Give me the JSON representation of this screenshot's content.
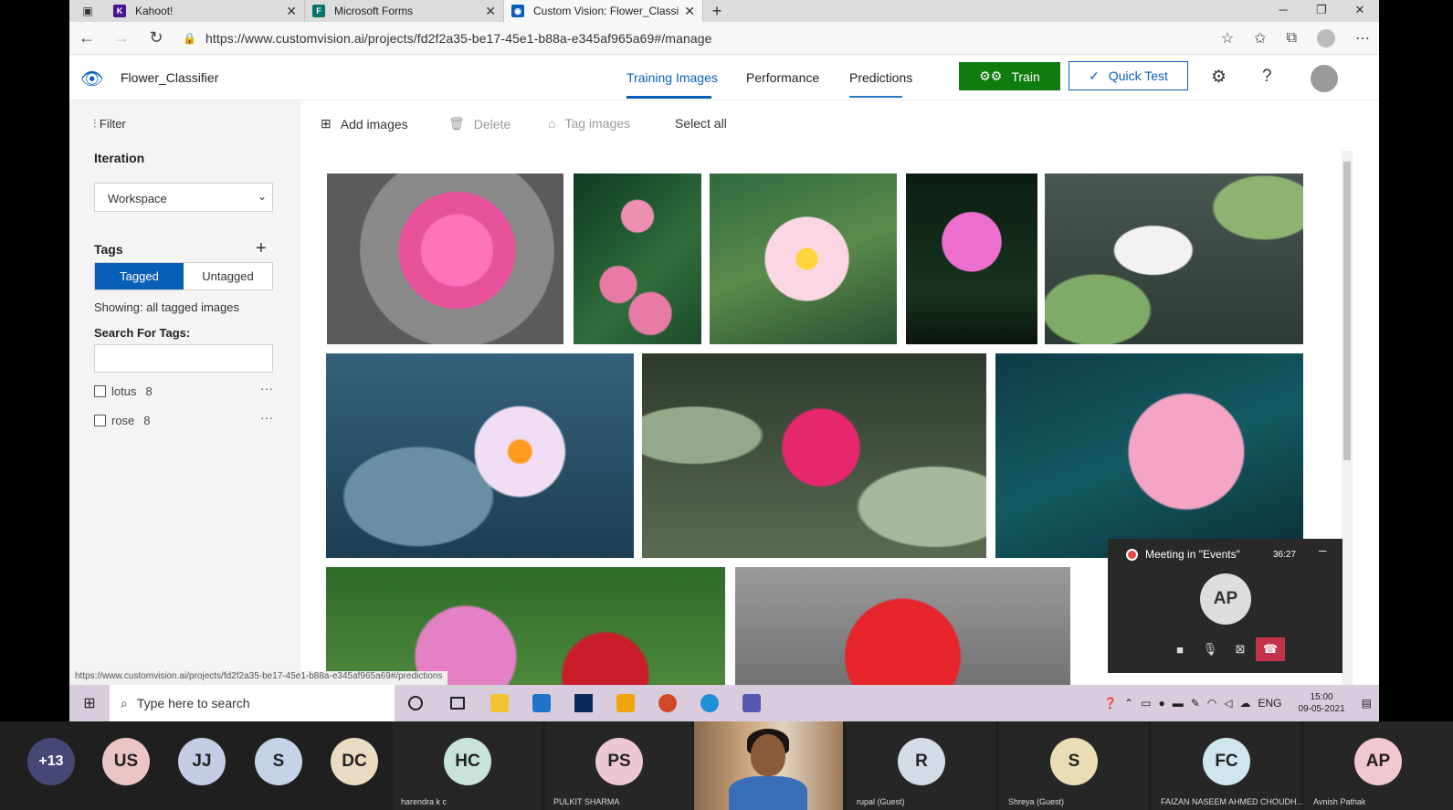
{
  "browser": {
    "tabs": [
      {
        "label": "Kahoot!",
        "icon": "kahoot-icon",
        "color": "#46178f"
      },
      {
        "label": "Microsoft Forms",
        "icon": "forms-icon",
        "color": "#077568"
      },
      {
        "label": "Custom Vision: Flower_Classifier",
        "icon": "customvision-icon",
        "color": "#0a5eb8",
        "active": true
      }
    ],
    "url": "https://www.customvision.ai/projects/fd2f2a35-be17-45e1-b88a-e345af965a69#/manage",
    "status_url": "https://www.customvision.ai/projects/fd2f2a35-be17-45e1-b88a-e345af965a69#/predictions"
  },
  "app": {
    "project_name": "Flower_Classifier",
    "nav": [
      "Training Images",
      "Performance",
      "Predictions"
    ],
    "active_nav": "Training Images",
    "train_label": "Train",
    "quick_test_label": "Quick Test",
    "accent_color": "#0a5eb8",
    "train_color": "#107c10"
  },
  "sidebar": {
    "filter_label": "Filter",
    "iteration_heading": "Iteration",
    "iteration_value": "Workspace",
    "tags_heading": "Tags",
    "tagged_label": "Tagged",
    "untagged_label": "Untagged",
    "showing_text": "Showing: all tagged images",
    "search_label": "Search For Tags:",
    "search_value": "",
    "tags": [
      {
        "name": "lotus",
        "count": "8"
      },
      {
        "name": "rose",
        "count": "8"
      }
    ]
  },
  "toolbar": {
    "add_images": "Add images",
    "delete": "Delete",
    "tag_images": "Tag images",
    "select_all": "Select all"
  },
  "gallery": {
    "images": [
      {
        "subject": "pink lotus",
        "tag": "lotus"
      },
      {
        "subject": "lotus buds",
        "tag": "lotus"
      },
      {
        "subject": "pink-white lotus",
        "tag": "lotus"
      },
      {
        "subject": "magenta lotus on dark",
        "tag": "lotus"
      },
      {
        "subject": "white lotus on pads",
        "tag": "lotus"
      },
      {
        "subject": "white lotus on water",
        "tag": "lotus"
      },
      {
        "subject": "red lotus on pads",
        "tag": "lotus"
      },
      {
        "subject": "pink lotus on blue",
        "tag": "lotus"
      },
      {
        "subject": "pink and red roses",
        "tag": "rose"
      },
      {
        "subject": "red rose",
        "tag": "rose"
      }
    ]
  },
  "meeting": {
    "title": "Meeting in \"Events\"",
    "time": "36:27",
    "avatar": "AP"
  },
  "taskbar": {
    "search_placeholder": "Type here to search",
    "lang": "ENG",
    "time": "15:00",
    "date": "09-05-2021"
  },
  "participants": [
    {
      "initials": "+13",
      "color": "#464775",
      "text": "#ffffff"
    },
    {
      "initials": "US",
      "color": "#e9c5c5"
    },
    {
      "initials": "JJ",
      "color": "#c5cce6"
    },
    {
      "initials": "S",
      "color": "#c5d3e6"
    },
    {
      "initials": "DC",
      "color": "#eadcc3"
    },
    {
      "initials": "HC",
      "color": "#c7e3da",
      "name": "harendra k c"
    },
    {
      "initials": "PS",
      "color": "#ecc9d2",
      "name": "PULKIT SHARMA"
    },
    {
      "initials": "R",
      "color": "#d3dbe4",
      "name": "rupal (Guest)"
    },
    {
      "initials": "S",
      "color": "#eadcb4",
      "name": "Shreya (Guest)"
    },
    {
      "initials": "FC",
      "color": "#cfe6ee",
      "name": "FAIZAN NASEEM AHMED CHOUDH..."
    },
    {
      "initials": "AP",
      "color": "#f0c8cf",
      "name": "Avnish Pathak"
    }
  ]
}
